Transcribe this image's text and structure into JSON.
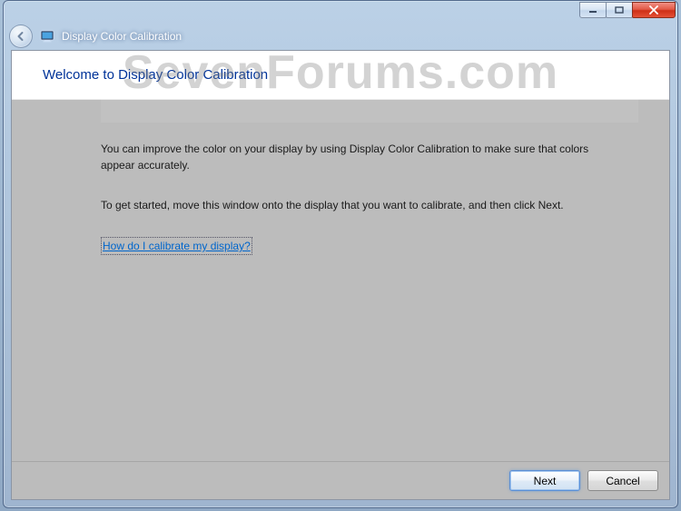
{
  "titlebar": {
    "app_title": "Display Color Calibration"
  },
  "page": {
    "heading": "Welcome to Display Color Calibration",
    "paragraph1": "You can improve the color on your display by using Display Color Calibration to make sure that colors appear accurately.",
    "paragraph2": "To get started, move this window onto the display that you want to calibrate, and then click Next.",
    "help_link": "How do I calibrate my display?"
  },
  "footer": {
    "next_label": "Next",
    "cancel_label": "Cancel"
  },
  "watermark": "SevenForums.com"
}
